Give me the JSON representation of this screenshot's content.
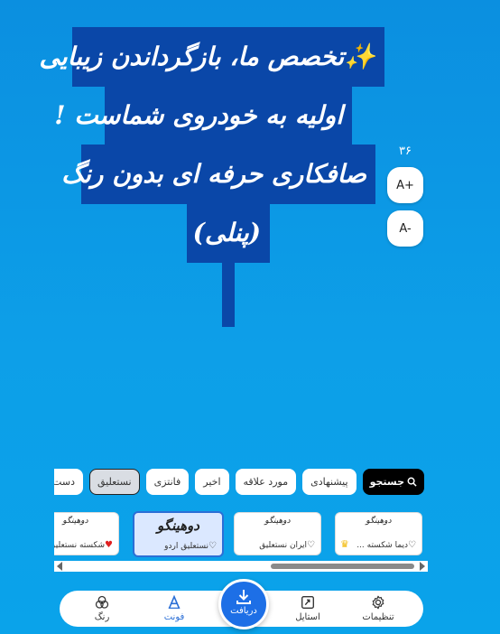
{
  "canvas": {
    "lines": [
      "✨تخصص ما، بازگرداندن زیبایی",
      "اولیه به خودروی شماست !",
      "صافکاری حرفه ای بدون رنگ",
      "(پنلی)"
    ],
    "highlight_color": "#0a47a8",
    "text_color": "#ffffff"
  },
  "size_controls": {
    "value": "۳۶",
    "increase_label": "A+",
    "decrease_label": "A-"
  },
  "font_categories": {
    "search_label": "جستجو",
    "items": [
      "پیشنهادی",
      "مورد علاقه",
      "اخیر",
      "فانتزی",
      "نستعلیق",
      "دست‌نویس"
    ],
    "active": "نستعلیق"
  },
  "font_cards": [
    {
      "preview": "دوهینگو",
      "name": "دیما شکسته ...",
      "badge": "crown-icon"
    },
    {
      "preview": "دوهینگو",
      "name": "ایران نستعلیق"
    },
    {
      "preview": "دوهینگو",
      "name": "نستعلیق اردو",
      "selected": true
    },
    {
      "preview": "دوهینگو",
      "name": "شکسته نستعلیق",
      "favorite": true
    }
  ],
  "bottom_nav": {
    "settings": "تنظیمات",
    "style": "استایل",
    "download": "دریافت",
    "font": "فونت",
    "color": "رنگ",
    "active": "فونت"
  },
  "colors": {
    "background": "#0b8fe0",
    "accent": "#1d6fe6",
    "favorite": "#e02020",
    "crown": "#f2b700"
  }
}
